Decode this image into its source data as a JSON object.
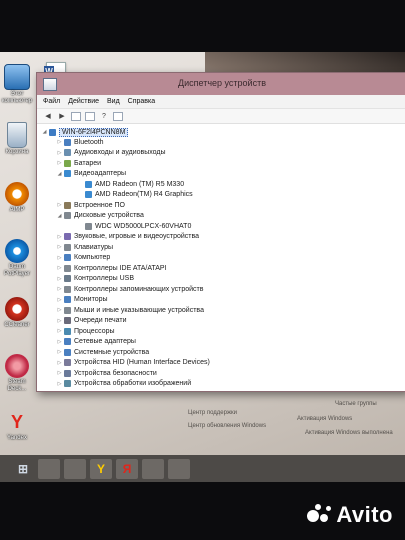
{
  "desktop": {
    "icons": [
      {
        "label": "Этот компьютер",
        "icon": "computer-icon"
      },
      {
        "label": "Корзина",
        "icon": "recycle-bin-icon"
      },
      {
        "label": "AIMP",
        "icon": "aimp-icon"
      },
      {
        "label": "Daum PotPlayer",
        "icon": "potplayer-icon"
      },
      {
        "label": "CCleaner",
        "icon": "ccleaner-icon"
      },
      {
        "label": "Steam Deck...",
        "icon": "app-icon"
      },
      {
        "label": "Yandex",
        "icon": "yandex-icon"
      }
    ],
    "watermark": {
      "support": "Центр поддержки",
      "update": "Центр обновления Windows",
      "activate": "Активация Windows",
      "activate_full": "Активация Windows выполнена",
      "partial": "Частые группы"
    }
  },
  "window": {
    "title": "Диспетчер устройств",
    "menu": [
      "Файл",
      "Действие",
      "Вид",
      "Справка"
    ],
    "root": "WIN-6F2I4PCNN8M",
    "tree": [
      {
        "label": "Bluetooth",
        "level": 1,
        "expanded": false,
        "icon": "bluetooth-icon"
      },
      {
        "label": "Аудиовходы и аудиовыходы",
        "level": 1,
        "expanded": false,
        "icon": "audio-icon"
      },
      {
        "label": "Батареи",
        "level": 1,
        "expanded": false,
        "icon": "battery-icon"
      },
      {
        "label": "Видеоадаптеры",
        "level": 1,
        "expanded": true,
        "icon": "display-adapter-icon"
      },
      {
        "label": "AMD Radeon (TM) R5 M330",
        "level": 2,
        "expanded": null,
        "icon": "display-adapter-icon"
      },
      {
        "label": "AMD Radeon(TM) R4 Graphics",
        "level": 2,
        "expanded": null,
        "icon": "display-adapter-icon"
      },
      {
        "label": "Встроенное ПО",
        "level": 1,
        "expanded": false,
        "icon": "firmware-icon"
      },
      {
        "label": "Дисковые устройства",
        "level": 1,
        "expanded": true,
        "icon": "disk-icon"
      },
      {
        "label": "WDC WD5000LPCX-60VHAT0",
        "level": 2,
        "expanded": null,
        "icon": "disk-icon"
      },
      {
        "label": "Звуковые, игровые и видеоустройства",
        "level": 1,
        "expanded": false,
        "icon": "sound-icon"
      },
      {
        "label": "Клавиатуры",
        "level": 1,
        "expanded": false,
        "icon": "keyboard-icon"
      },
      {
        "label": "Компьютер",
        "level": 1,
        "expanded": false,
        "icon": "computer-icon"
      },
      {
        "label": "Контроллеры IDE ATA/ATAPI",
        "level": 1,
        "expanded": false,
        "icon": "ide-controller-icon"
      },
      {
        "label": "Контроллеры USB",
        "level": 1,
        "expanded": false,
        "icon": "usb-icon"
      },
      {
        "label": "Контроллеры запоминающих устройств",
        "level": 1,
        "expanded": false,
        "icon": "storage-controller-icon"
      },
      {
        "label": "Мониторы",
        "level": 1,
        "expanded": false,
        "icon": "monitor-icon"
      },
      {
        "label": "Мыши и иные указывающие устройства",
        "level": 1,
        "expanded": false,
        "icon": "mouse-icon"
      },
      {
        "label": "Очереди печати",
        "level": 1,
        "expanded": false,
        "icon": "printer-icon"
      },
      {
        "label": "Процессоры",
        "level": 1,
        "expanded": false,
        "icon": "processor-icon"
      },
      {
        "label": "Сетевые адаптеры",
        "level": 1,
        "expanded": false,
        "icon": "network-adapter-icon"
      },
      {
        "label": "Системные устройства",
        "level": 1,
        "expanded": false,
        "icon": "system-device-icon"
      },
      {
        "label": "Устройства HID (Human Interface Devices)",
        "level": 1,
        "expanded": false,
        "icon": "hid-icon"
      },
      {
        "label": "Устройства безопасности",
        "level": 1,
        "expanded": false,
        "icon": "security-device-icon"
      },
      {
        "label": "Устройства обработки изображений",
        "level": 1,
        "expanded": false,
        "icon": "camera-icon"
      }
    ]
  },
  "overlay": {
    "brand": "Avito"
  }
}
